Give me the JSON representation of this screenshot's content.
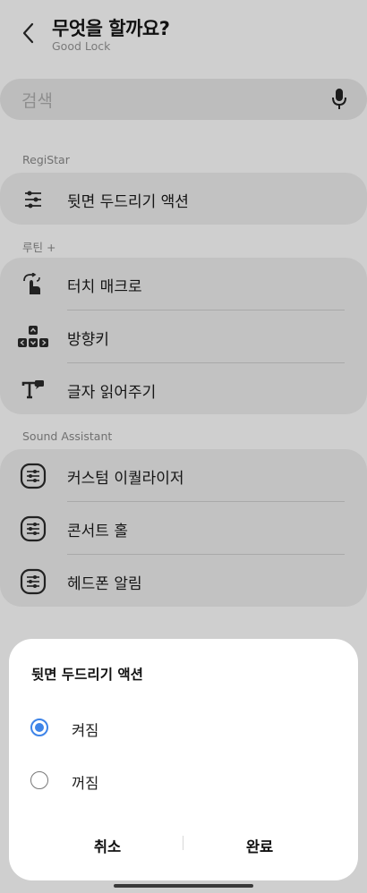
{
  "header": {
    "title": "무엇을 할까요?",
    "subtitle": "Good Lock"
  },
  "search": {
    "placeholder": "검색"
  },
  "sections": [
    {
      "label": "RegiStar",
      "items": [
        {
          "label": "뒷면 두드리기 액션",
          "icon": "sliders-icon"
        }
      ]
    },
    {
      "label": "루틴 +",
      "items": [
        {
          "label": "터치 매크로",
          "icon": "touch-macro-icon"
        },
        {
          "label": "방향키",
          "icon": "arrow-keys-icon"
        },
        {
          "label": "글자 읽어주기",
          "icon": "text-to-speech-icon"
        }
      ]
    },
    {
      "label": "Sound Assistant",
      "items": [
        {
          "label": "커스텀 이퀄라이저",
          "icon": "equalizer-icon"
        },
        {
          "label": "콘서트 홀",
          "icon": "equalizer-icon"
        },
        {
          "label": "헤드폰 알림",
          "icon": "equalizer-icon"
        }
      ]
    }
  ],
  "dialog": {
    "title": "뒷면 두드리기 액션",
    "options": [
      {
        "label": "켜짐",
        "selected": true
      },
      {
        "label": "꺼짐",
        "selected": false
      }
    ],
    "cancel_label": "취소",
    "done_label": "완료"
  },
  "colors": {
    "accent": "#3e84e8",
    "scrim_background": "#cfcfcf",
    "sheet_background": "#ffffff"
  }
}
